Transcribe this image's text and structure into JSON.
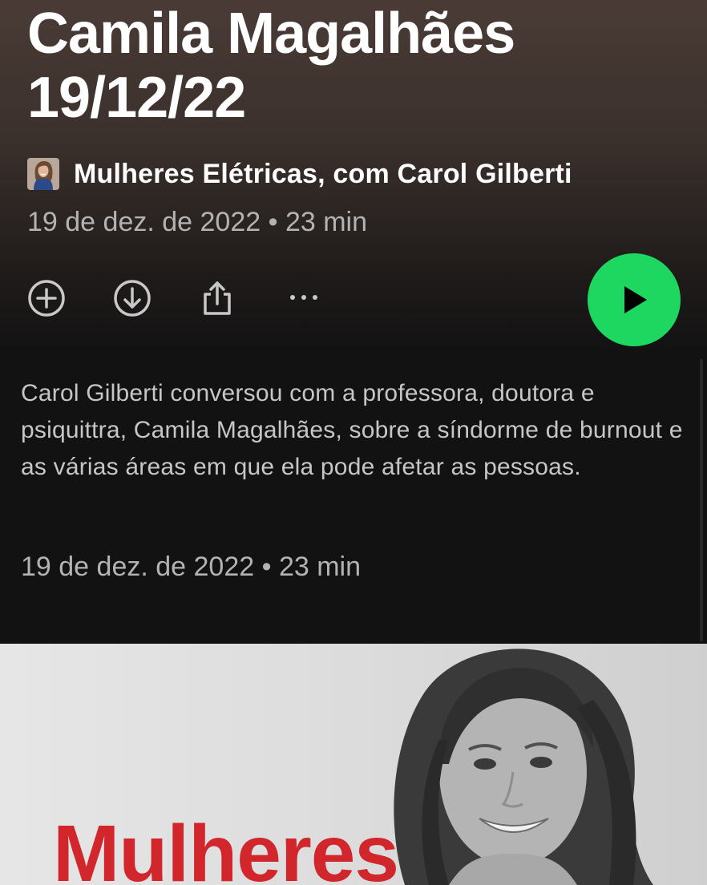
{
  "episode": {
    "title_line1": "Camila Magalhães",
    "title_line2": "19/12/22"
  },
  "show": {
    "name": "Mulheres Elétricas, com Carol Gilberti",
    "avatar_icon": "host-avatar-thumbnail"
  },
  "meta": {
    "date": "19 de dez. de 2022",
    "separator": "•",
    "duration": "23 min"
  },
  "actions": {
    "add_icon": "plus-circle-icon",
    "download_icon": "download-circle-icon",
    "share_icon": "share-icon",
    "more_icon": "more-horizontal-icon",
    "play_icon": "play-icon"
  },
  "description": "Carol Gilberti conversou com a professora, doutora e psiquittra, Camila Magalhães, sobre a síndorme de burnout e as várias áreas em que ela pode afetar as pessoas.",
  "cover": {
    "brand_text": "Mulheres"
  },
  "colors": {
    "play_green": "#1ed760",
    "cover_red": "#d1262b",
    "background": "#121212"
  }
}
